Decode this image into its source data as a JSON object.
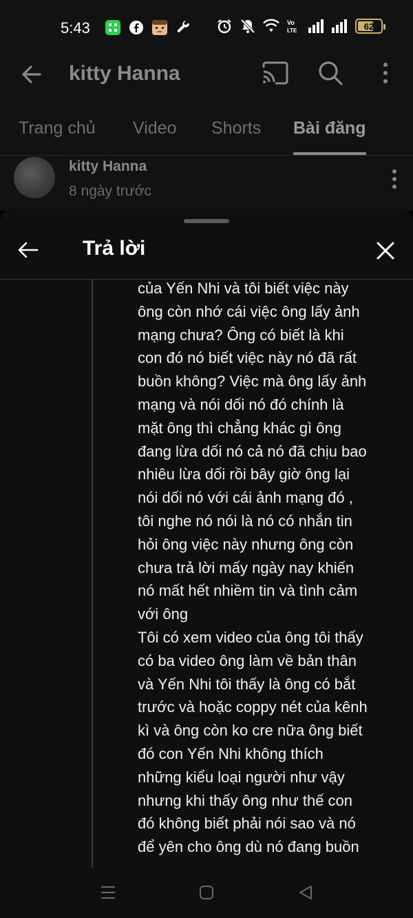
{
  "status_bar": {
    "time": "5:43",
    "battery": "62",
    "network": "Vo LTE",
    "left_icons": [
      "app-grid-icon",
      "facebook-icon",
      "avatar-app-icon",
      "wrench-icon"
    ],
    "right_icons": [
      "alarm-icon",
      "mute-icon",
      "wifi-icon",
      "volte-icon",
      "signal-icon",
      "signal-icon"
    ]
  },
  "app_bar": {
    "title": "kitty Hanna"
  },
  "tabs": [
    "Trang chủ",
    "Video",
    "Shorts",
    "Bài đăng"
  ],
  "active_tab": "Bài đăng",
  "post": {
    "author": "kitty Hanna",
    "time": "8 ngày trước"
  },
  "sheet": {
    "title": "Trả lời",
    "comment": "của Yến Nhi và tôi biết việc này\nông còn nhớ cái việc ông lấy ảnh\nmạng chưa? Ông có biết là khi\ncon đó nó biết việc này nó đã rất\nbuồn không? Việc mà ông lấy ảnh\nmạng và nói dối nó đó chính là\nmặt ông thì chẳng khác gì ông\nđang lừa dối nó cả nó đã chịu bao\nnhiêu lừa dối rồi bây giờ ông lại\nnói dối nó với cái ảnh mạng đó ,\ntôi nghe nó nói là nó có nhắn tin\nhỏi ông việc này nhưng ông còn\nchưa trả lời mấy ngày nay khiến\nnó mất hết nhiềm tin và tình cảm\nvới ông\nTôi có xem video của ông tôi thấy\ncó ba video ông làm về bản thân\nvà Yến Nhi tôi thấy là ông có bắt\ntrước và hoặc coppy nét của kênh\nkì và ông còn ko cre nữa ông biết\nđó con Yến Nhi không thích\nnhững kiểu loại người như vậy\nnhưng khi thấy ông như thế con\nđó không biết phải nói sao và nó\nđể yên cho ông dù nó đang buồn"
  },
  "colors": {
    "background": "#0f0f0f",
    "accent_battery": "#c9b26a",
    "text": "#f1f1f1"
  }
}
